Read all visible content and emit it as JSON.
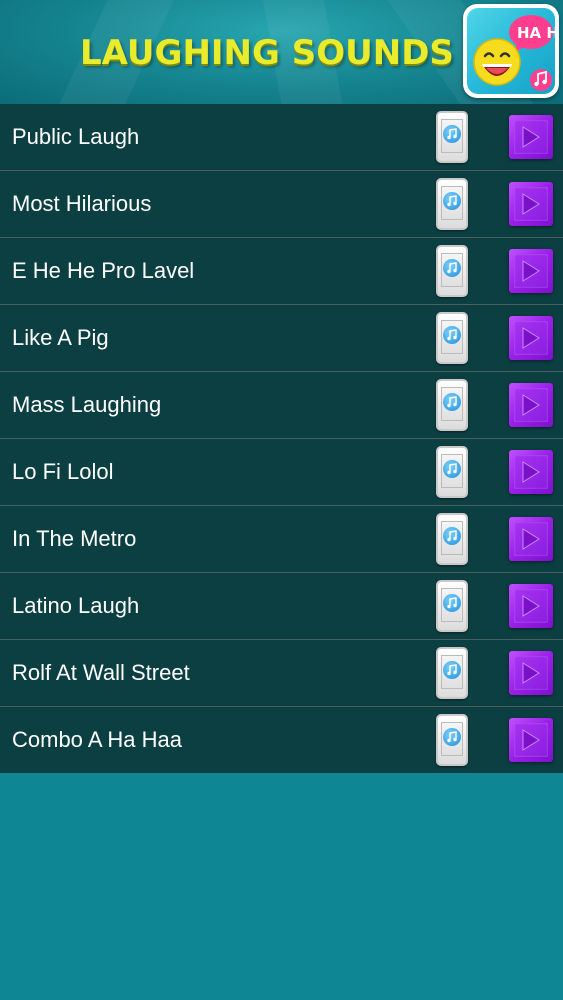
{
  "header": {
    "title": "LAUGHING SOUNDS",
    "app_icon": {
      "name": "laughing-emoji-icon",
      "bubble_text": "HA HA",
      "note_icon": "music-note-icon"
    }
  },
  "sounds": [
    {
      "label": "Public Laugh"
    },
    {
      "label": "Most Hilarious"
    },
    {
      "label": "E He He Pro Lavel"
    },
    {
      "label": "Like A Pig"
    },
    {
      "label": "Mass Laughing"
    },
    {
      "label": "Lo Fi Lolol"
    },
    {
      "label": "In The Metro"
    },
    {
      "label": "Latino Laugh"
    },
    {
      "label": "Rolf At Wall Street"
    },
    {
      "label": "Combo A Ha Haa"
    }
  ],
  "icons": {
    "ringtone": "phone-ringtone-icon",
    "play": "play-icon"
  },
  "colors": {
    "background": "#0e8694",
    "row": "#0c3f42",
    "title": "#e8ec2c",
    "play": "#9a1fe8"
  }
}
